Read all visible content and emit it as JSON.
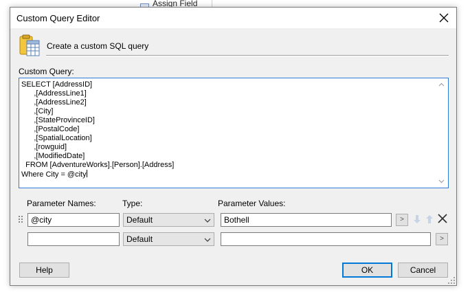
{
  "background": {
    "item_label": "Assign Field"
  },
  "dialog": {
    "title": "Custom Query Editor",
    "header_text": "Create a custom SQL query",
    "custom_query_label": "Custom Query:",
    "query_lines": [
      "SELECT [AddressID]",
      "      ,[AddressLine1]",
      "      ,[AddressLine2]",
      "      ,[City]",
      "      ,[StateProvinceID]",
      "      ,[PostalCode]",
      "      ,[SpatialLocation]",
      "      ,[rowguid]",
      "      ,[ModifiedDate]",
      "  FROM [AdventureWorks].[Person].[Address]",
      "Where City = @city"
    ],
    "params": {
      "col_names": "Parameter Names:",
      "col_type": "Type:",
      "col_values": "Parameter Values:",
      "rows": [
        {
          "name": "@city",
          "type": "Default",
          "value": "Bothell",
          "more": ">"
        },
        {
          "name": "",
          "type": "Default",
          "value": "",
          "more": ">"
        }
      ]
    },
    "buttons": {
      "help": "Help",
      "ok": "OK",
      "cancel": "Cancel"
    }
  },
  "colors": {
    "accent": "#0078d7",
    "focus_border": "#2f7ad7",
    "dialog_bg": "#f0f0f0"
  },
  "icons": [
    "close-icon",
    "query-editor-icon",
    "move-down-icon",
    "move-up-icon",
    "delete-icon",
    "chevron-down-icon",
    "scroll-up-icon",
    "scroll-down-icon",
    "drag-handle-icon"
  ]
}
